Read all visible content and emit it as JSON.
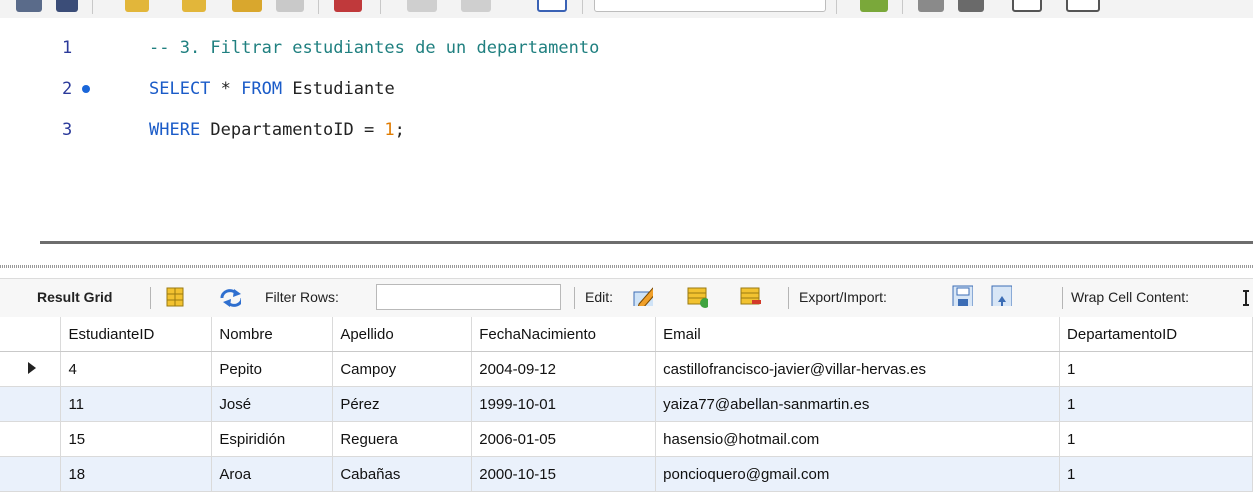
{
  "editor": {
    "lines": [
      {
        "number": "1",
        "comment": "-- 3. Filtrar estudiantes de un departamento"
      },
      {
        "number": "2",
        "kw1": "SELECT",
        "star": " * ",
        "kw2": "FROM",
        "table": " Estudiante"
      },
      {
        "number": "3",
        "kw": "WHERE",
        "cond": " DepartamentoID = ",
        "value": "1",
        "end": ";"
      }
    ]
  },
  "result_toolbar": {
    "result_grid_label": "Result Grid",
    "filter_rows_label": "Filter Rows:",
    "filter_value": "",
    "edit_label": "Edit:",
    "export_import_label": "Export/Import:",
    "wrap_cell_label": "Wrap Cell Content:"
  },
  "grid": {
    "columns": [
      "EstudianteID",
      "Nombre",
      "Apellido",
      "FechaNacimiento",
      "Email",
      "DepartamentoID"
    ],
    "rows": [
      [
        "4",
        "Pepito",
        "Campoy",
        "2004-09-12",
        "castillofrancisco-javier@villar-hervas.es",
        "1"
      ],
      [
        "11",
        "José",
        "Pérez",
        "1999-10-01",
        "yaiza77@abellan-sanmartin.es",
        "1"
      ],
      [
        "15",
        "Espiridión",
        "Reguera",
        "2006-01-05",
        "hasensio@hotmail.com",
        "1"
      ],
      [
        "18",
        "Aroa",
        "Cabañas",
        "2000-10-15",
        "poncioquero@gmail.com",
        "1"
      ]
    ]
  },
  "colors": {
    "keyword": "#1a5bc8",
    "comment": "#208080",
    "number": "#e07b00",
    "line_number": "#2b3a9a",
    "alt_row": "#eaf1fb"
  }
}
